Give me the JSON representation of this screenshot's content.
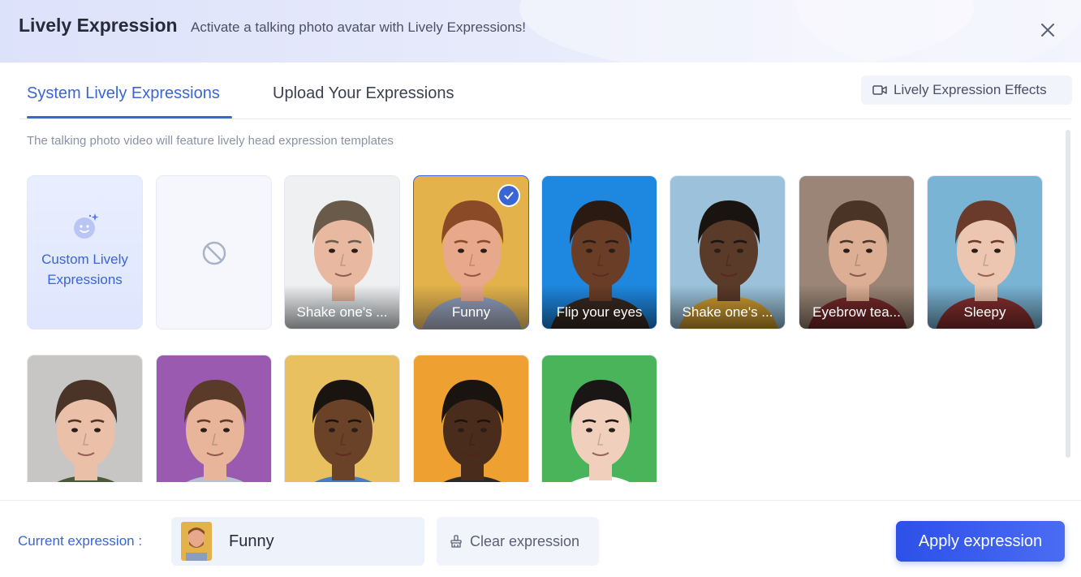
{
  "header": {
    "title": "Lively Expression",
    "subtitle": "Activate a talking photo avatar with Lively Expressions!",
    "close_icon": "close-icon"
  },
  "tabs": [
    {
      "label": "System Lively Expressions",
      "active": true
    },
    {
      "label": "Upload Your Expressions",
      "active": false
    }
  ],
  "effects_button": {
    "label": "Lively Expression Effects",
    "icon": "video-camera-icon"
  },
  "hint": "The talking photo video will feature lively head expression templates",
  "custom_card": {
    "label": "Custom Lively Expressions",
    "icon": "sparkle-face-icon"
  },
  "none_card": {
    "icon": "prohibited-icon"
  },
  "expressions": [
    {
      "label": "Shake one's ...",
      "selected": false,
      "bg": "#eef0f2",
      "skin": "#e8b9a0",
      "hair": "#6a5a4a",
      "shirt": "#e9eef2"
    },
    {
      "label": "Funny",
      "selected": true,
      "bg": "#e3b24a",
      "skin": "#e8a88c",
      "hair": "#8a4a28",
      "shirt": "#8a9cc0"
    },
    {
      "label": "Flip your eyes",
      "selected": false,
      "bg": "#1e88e0",
      "skin": "#6a3e26",
      "hair": "#2a1a12",
      "shirt": "#3a2a22"
    },
    {
      "label": "Shake one's ...",
      "selected": false,
      "bg": "#9bc2da",
      "skin": "#5a3a28",
      "hair": "#1a1410",
      "shirt": "#d4a030"
    },
    {
      "label": "Eyebrow tea...",
      "selected": false,
      "bg": "#9a8576",
      "skin": "#dcae94",
      "hair": "#4a3426",
      "shirt": "#7a2a2a"
    },
    {
      "label": "Sleepy",
      "selected": false,
      "bg": "#7ab4d4",
      "skin": "#ecc6b0",
      "hair": "#6a3a2a",
      "shirt": "#8a3030"
    },
    {
      "label": "",
      "selected": false,
      "bg": "#c8c6c4",
      "skin": "#eac0a8",
      "hair": "#4a3428",
      "shirt": "#4a5a3a"
    },
    {
      "label": "",
      "selected": false,
      "bg": "#9a5ab0",
      "skin": "#e8b49a",
      "hair": "#5a3a28",
      "shirt": "#b8c0d0"
    },
    {
      "label": "",
      "selected": false,
      "bg": "#e8c060",
      "skin": "#6a4228",
      "hair": "#1a1410",
      "shirt": "#4a7ac0"
    },
    {
      "label": "",
      "selected": false,
      "bg": "#eea030",
      "skin": "#4a2c1c",
      "hair": "#1a1410",
      "shirt": "#2a2a2a"
    },
    {
      "label": "",
      "selected": false,
      "bg": "#4ab45a",
      "skin": "#f0d0bc",
      "hair": "#1a1616",
      "shirt": "#ffffff"
    }
  ],
  "footer": {
    "current_label": "Current expression :",
    "current_name": "Funny",
    "clear_label": "Clear expression",
    "clear_icon": "broom-icon",
    "apply_label": "Apply expression"
  },
  "colors": {
    "accent": "#3a65d4",
    "apply": "#2d50e8"
  }
}
